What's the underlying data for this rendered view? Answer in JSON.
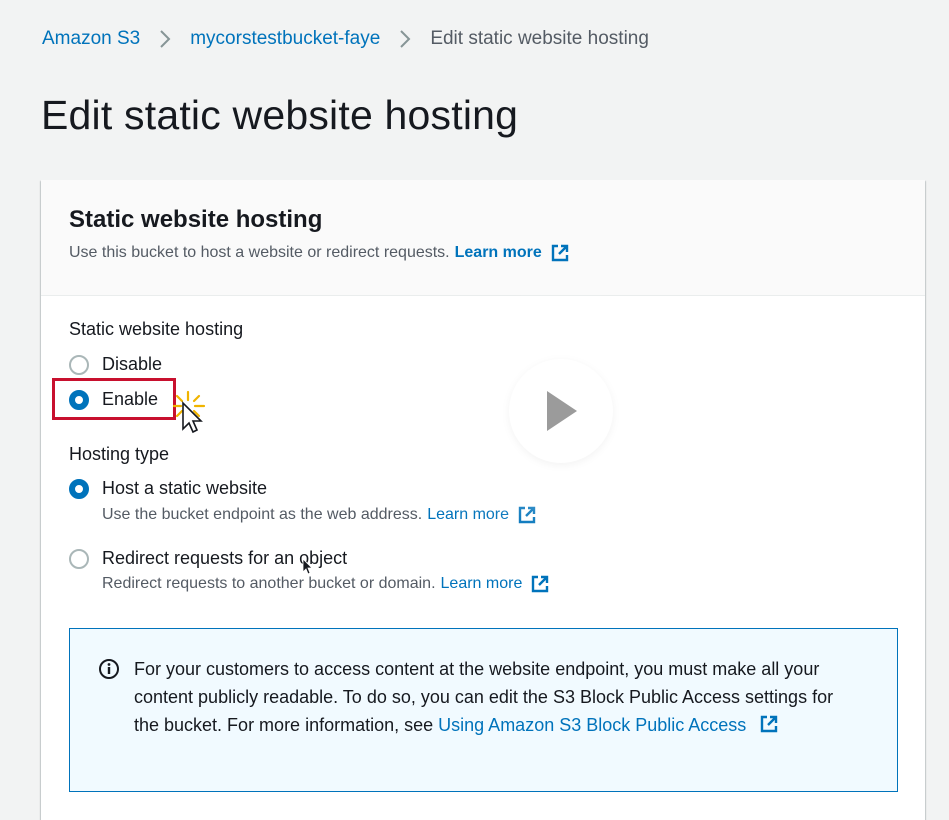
{
  "breadcrumb": {
    "items": [
      {
        "label": "Amazon S3"
      },
      {
        "label": "mycorstestbucket-faye"
      },
      {
        "label": "Edit static website hosting"
      }
    ]
  },
  "page": {
    "title": "Edit static website hosting"
  },
  "panel": {
    "title": "Static website hosting",
    "description": "Use this bucket to host a website or redirect requests.",
    "learn_more": "Learn more"
  },
  "hosting": {
    "label": "Static website hosting",
    "options": [
      {
        "label": "Disable",
        "selected": false
      },
      {
        "label": "Enable",
        "selected": true
      }
    ]
  },
  "hosting_type": {
    "label": "Hosting type",
    "options": [
      {
        "label": "Host a static website",
        "description": "Use the bucket endpoint as the web address.",
        "learn_more": "Learn more",
        "selected": true
      },
      {
        "label": "Redirect requests for an object",
        "description": "Redirect requests to another bucket or domain.",
        "learn_more": "Learn more",
        "selected": false
      }
    ]
  },
  "info": {
    "text": "For your customers to access content at the website endpoint, you must make all your content publicly readable. To do so, you can edit the S3 Block Public Access settings for the bucket. For more information, see",
    "link": "Using Amazon S3 Block Public Access"
  },
  "icons": {
    "chevron": "chevron-right-icon",
    "external": "external-link-icon",
    "info": "info-icon",
    "play": "play-icon",
    "cursor": "mouse-pointer-icon"
  },
  "colors": {
    "link": "#0073bb",
    "highlight": "#c8102e",
    "info_bg": "#f1faff"
  }
}
